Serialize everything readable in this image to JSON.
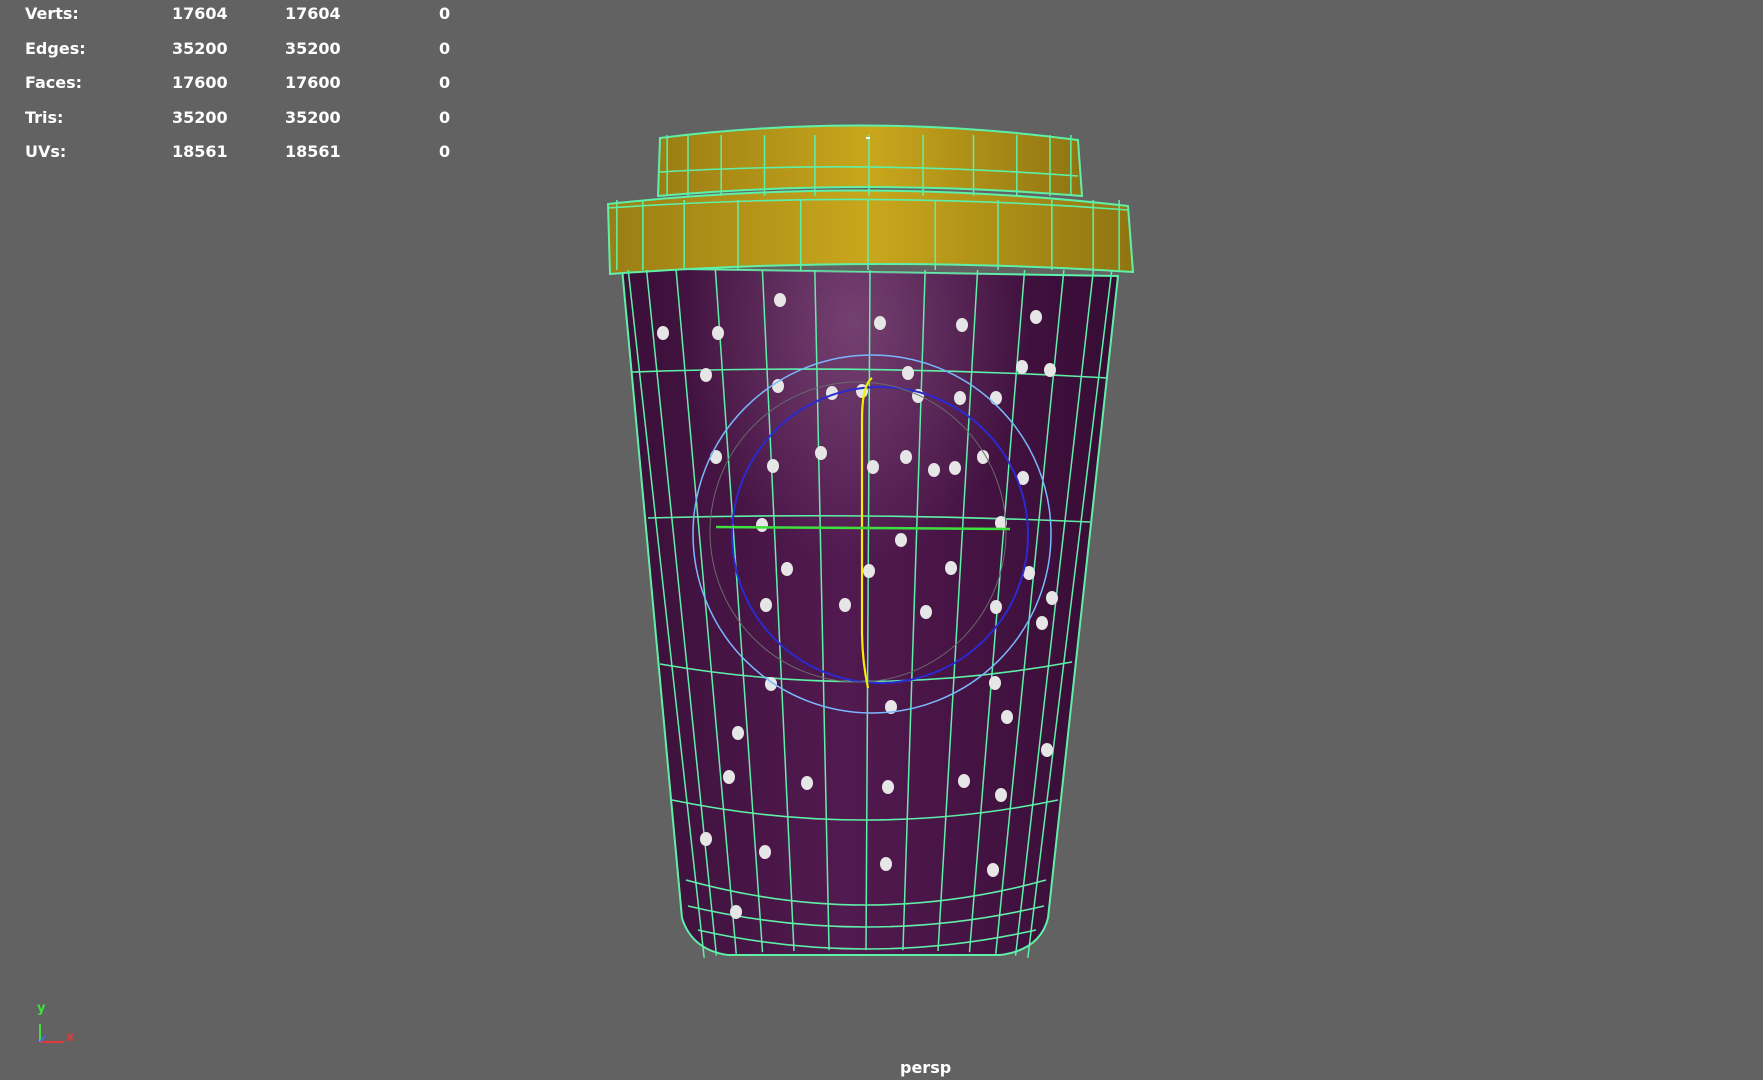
{
  "hud": {
    "rows": [
      {
        "label": "Verts:",
        "col1": "17604",
        "col2": "17604",
        "col3": "0"
      },
      {
        "label": "Edges:",
        "col1": "35200",
        "col2": "35200",
        "col3": "0"
      },
      {
        "label": "Faces:",
        "col1": "17600",
        "col2": "17600",
        "col3": "0"
      },
      {
        "label": "Tris:",
        "col1": "35200",
        "col2": "35200",
        "col3": "0"
      },
      {
        "label": "UVs:",
        "col1": "18561",
        "col2": "18561",
        "col3": "0"
      }
    ]
  },
  "viewport": {
    "camera_label": "persp",
    "background": "#626262"
  },
  "axis_indicator": {
    "y_label": "y",
    "x_label": "x",
    "y_color": "#3ee03e",
    "x_color": "#e23a3a",
    "z_color": "#4a6af0"
  },
  "model": {
    "body_color": "#4a1448",
    "lid_color": "#b89a1a",
    "wire_color": "#5ff0a8",
    "dot_color": "#e6e6e6"
  },
  "manipulator": {
    "outer_ring_color": "#7ab8ff",
    "inner_ring_color": "#2a2ad0",
    "vertical_axis_color": "#f0f000",
    "horizontal_axis_color": "#3ee03e"
  }
}
